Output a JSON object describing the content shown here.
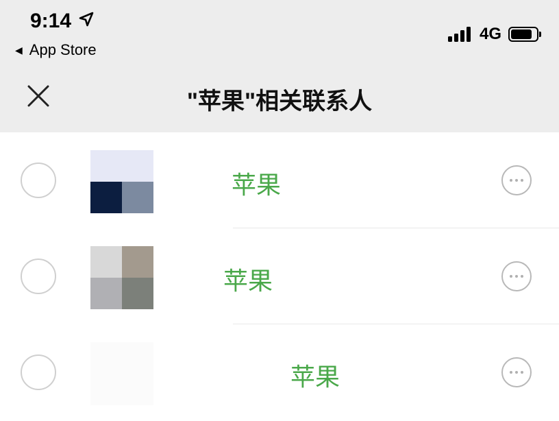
{
  "status_bar": {
    "time": "9:14",
    "back_app": "App Store",
    "network": "4G",
    "icons": [
      "location-arrow-icon",
      "signal-icon",
      "battery-icon"
    ]
  },
  "nav": {
    "close_icon": "close-icon",
    "title": "\"苹果\"相关联系人"
  },
  "contacts": [
    {
      "name": "苹果",
      "avatar_colors": [
        "#e6e8f6",
        "#e6e8f6",
        "#0c1e40",
        "#7c8aa0"
      ],
      "more_icon": "more-icon"
    },
    {
      "name": "苹果",
      "avatar_colors": [
        "#d8d8d8",
        "#a39a8e",
        "#b0b0b4",
        "#7c807a"
      ],
      "more_icon": "more-icon"
    },
    {
      "name": "苹果",
      "avatar_colors": [
        "#fbfbfb",
        "#fbfbfb",
        "#fbfbfb",
        "#fbfbfb"
      ],
      "more_icon": "more-icon"
    }
  ],
  "colors": {
    "header_bg": "#ededed",
    "name_green": "#4aa84a"
  }
}
